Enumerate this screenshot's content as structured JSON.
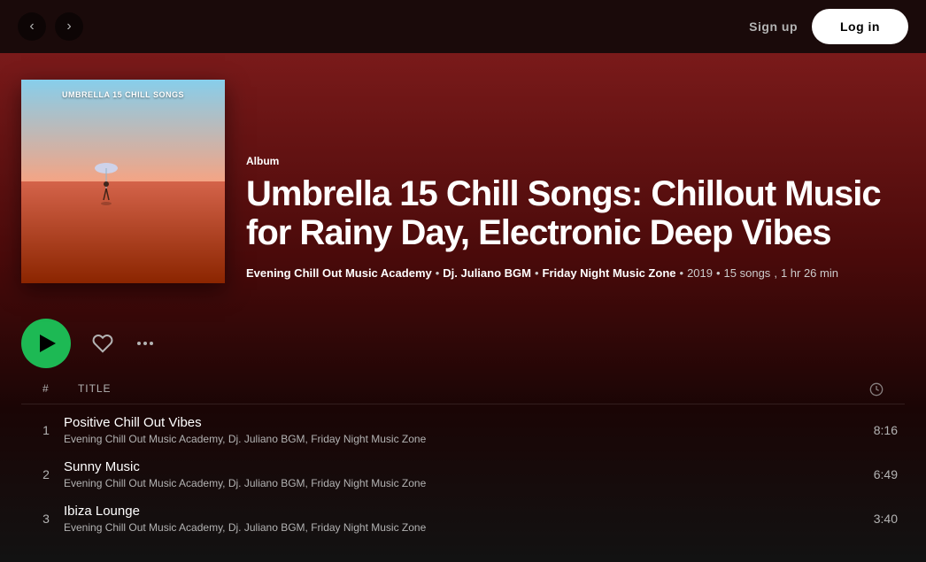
{
  "topBar": {
    "navBack": "‹",
    "navForward": "›",
    "signUpLabel": "Sign up",
    "logInLabel": "Log in"
  },
  "album": {
    "type": "Album",
    "title": "Umbrella 15 Chill Songs: Chillout Music for Rainy Day, Electronic Deep Vibes",
    "coverText": "UMBRELLA 15 CHILL SONGS",
    "artists": [
      "Evening Chill Out Music Academy",
      "Dj. Juliano BGM",
      "Friday Night Music Zone"
    ],
    "year": "2019",
    "songCount": "15 songs",
    "duration": "1 hr 26 min"
  },
  "trackListHeader": {
    "numberCol": "#",
    "titleCol": "Title"
  },
  "tracks": [
    {
      "number": "1",
      "name": "Positive Chill Out Vibes",
      "artists": "Evening Chill Out Music Academy, Dj. Juliano BGM, Friday Night Music Zone",
      "duration": "8:16"
    },
    {
      "number": "2",
      "name": "Sunny Music",
      "artists": "Evening Chill Out Music Academy, Dj. Juliano BGM, Friday Night Music Zone",
      "duration": "6:49"
    },
    {
      "number": "3",
      "name": "Ibiza Lounge",
      "artists": "Evening Chill Out Music Academy, Dj. Juliano BGM, Friday Night Music Zone",
      "duration": "3:40"
    }
  ],
  "colors": {
    "playBtn": "#1db954",
    "background": "#121212",
    "headerGrad": "#7a1a1a"
  }
}
